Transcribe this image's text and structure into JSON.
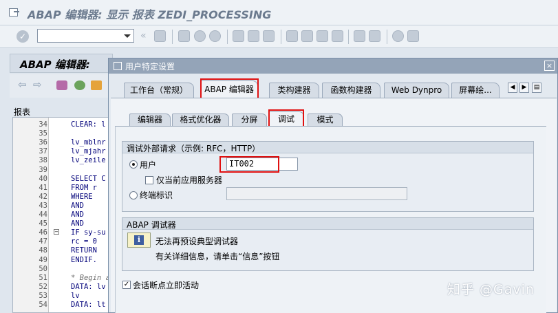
{
  "window": {
    "title": "ABAP 编辑器: 显示 报表 ZEDI_PROCESSING"
  },
  "toolbar": {
    "command_value": "",
    "icons": [
      "enter-icon",
      "save-icon",
      "back-icon",
      "exit-icon",
      "cancel-icon",
      "print-icon",
      "find-icon",
      "find-next-icon",
      "first-page-icon",
      "prev-page-icon",
      "next-page-icon",
      "last-page-icon",
      "create-session-icon",
      "shortcut-icon",
      "help-icon",
      "customize-layout-icon"
    ]
  },
  "editor": {
    "header": "ABAP 编辑器:",
    "section_label": "报表",
    "lines": [
      {
        "no": "34",
        "code": "CLEAR: l"
      },
      {
        "no": "35",
        "code": ""
      },
      {
        "no": "36",
        "code": "lv_mblnr"
      },
      {
        "no": "37",
        "code": "lv_mjahr"
      },
      {
        "no": "38",
        "code": "lv_zeile"
      },
      {
        "no": "39",
        "code": ""
      },
      {
        "no": "40",
        "code": "SELECT C"
      },
      {
        "no": "41",
        "code": "  FROM r"
      },
      {
        "no": "42",
        "code": "  WHERE"
      },
      {
        "no": "43",
        "code": "    AND"
      },
      {
        "no": "44",
        "code": "    AND"
      },
      {
        "no": "45",
        "code": "    AND"
      },
      {
        "no": "46",
        "code": "IF sy-su"
      },
      {
        "no": "47",
        "code": "  rc = 0"
      },
      {
        "no": "48",
        "code": "  RETURN"
      },
      {
        "no": "49",
        "code": "ENDIF."
      },
      {
        "no": "50",
        "code": ""
      },
      {
        "no": "51",
        "code": "* Begin ad"
      },
      {
        "no": "52",
        "code": "DATA: lv"
      },
      {
        "no": "53",
        "code": "      lv"
      },
      {
        "no": "54",
        "code": "DATA: lt"
      }
    ]
  },
  "dialog": {
    "title": "用户特定设置",
    "main_tabs": [
      "工作台（常规）",
      "ABAP 编辑器",
      "类构建器",
      "函数构建器",
      "Web Dynpro",
      "屏幕绘..."
    ],
    "active_main_tab": "ABAP 编辑器",
    "sub_tabs": [
      "编辑器",
      "格式优化器",
      "分屏",
      "调试",
      "模式"
    ],
    "active_sub_tab": "调试",
    "external_debug": {
      "title": "调试外部请求（示例: RFC，HTTP）",
      "user_radio_label": "用户",
      "user_value": "IT002",
      "only_current_server_label": "仅当前应用服务器",
      "terminal_radio_label": "终端标识",
      "terminal_value": ""
    },
    "abap_debugger": {
      "title": "ABAP 调试器",
      "info_line1": "无法再预设典型调试器",
      "info_line2": "有关详细信息，请单击“信息”按钮"
    },
    "session_breakpoint_label": "会话断点立即活动"
  },
  "watermark": "知乎 @Gavin"
}
